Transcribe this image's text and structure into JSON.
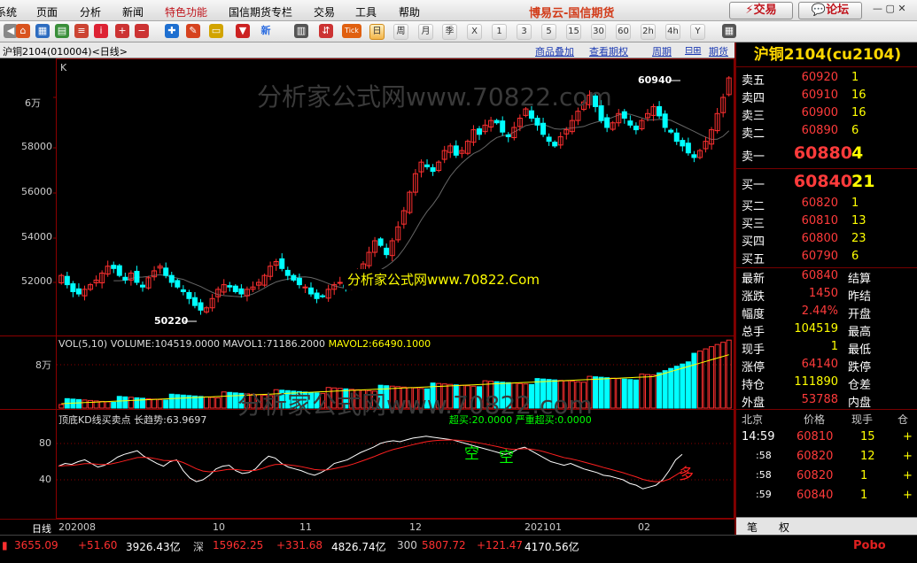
{
  "menu": [
    "系统",
    "页面",
    "分析",
    "新闻",
    "特色功能",
    "国信期货专栏",
    "交易",
    "工具",
    "帮助"
  ],
  "brand": "博易云-国信期货",
  "trade_btn": "交易",
  "forum_btn": "论坛",
  "toolbar_labels": [
    "新",
    "Tick",
    "日",
    "周",
    "月",
    "季",
    "X",
    "1",
    "3",
    "5",
    "15",
    "30",
    "60",
    "2h",
    "4h",
    "Y"
  ],
  "chart": {
    "title": "沪铜2104(010004)<日线>",
    "links": [
      "商品叠加",
      "查看期权",
      "周期",
      "期货"
    ],
    "k_label": "K",
    "high_label": "60940",
    "low_label": "50220",
    "y_ticks": [
      "6万",
      "58000",
      "56000",
      "54000",
      "52000"
    ],
    "watermark": "分析家公式网www.70822.com",
    "watermark2": "分析家公式网www.70822.Com",
    "vol_header": "VOL(5,10)  VOLUME:104519.0000  MAVOL1:71186.2000",
    "vol_mavol2": "MAVOL2:66490.1000",
    "vol_tick": "8万",
    "kd_header": "顶底KD线买卖点  长趋势:63.9697",
    "kd_extra": "超买:20.0000  严重超买:0.0000",
    "kd_ticks": [
      "80",
      "40"
    ],
    "kd_marks": [
      "空",
      "空",
      "多"
    ],
    "dates_label": "日线",
    "dates": [
      "202008",
      "10",
      "11",
      "12",
      "202101",
      "02"
    ]
  },
  "quote": {
    "title": "沪铜2104(cu2104)",
    "sells": [
      {
        "l": "卖五",
        "p": "60920",
        "v": "1"
      },
      {
        "l": "卖四",
        "p": "60910",
        "v": "16"
      },
      {
        "l": "卖三",
        "p": "60900",
        "v": "16"
      },
      {
        "l": "卖二",
        "p": "60890",
        "v": "6"
      }
    ],
    "sell1": {
      "l": "卖一",
      "p": "60880",
      "v": "4"
    },
    "buy1": {
      "l": "买一",
      "p": "60840",
      "v": "21"
    },
    "buys": [
      {
        "l": "买二",
        "p": "60820",
        "v": "1"
      },
      {
        "l": "买三",
        "p": "60810",
        "v": "13"
      },
      {
        "l": "买四",
        "p": "60800",
        "v": "23"
      },
      {
        "l": "买五",
        "p": "60790",
        "v": "6"
      }
    ],
    "stats": [
      {
        "l": "最新",
        "v": "60840",
        "r": "结算"
      },
      {
        "l": "涨跌",
        "v": "1450",
        "r": "昨结"
      },
      {
        "l": "幅度",
        "v": "2.44%",
        "r": "开盘"
      },
      {
        "l": "总手",
        "v": "104519",
        "r": "最高"
      },
      {
        "l": "现手",
        "v": "1",
        "r": "最低"
      },
      {
        "l": "涨停",
        "v": "64140",
        "r": "跌停"
      },
      {
        "l": "持仓",
        "v": "111890",
        "r": "仓差"
      },
      {
        "l": "外盘",
        "v": "53788",
        "r": "内盘"
      }
    ],
    "tick_head": [
      "北京",
      "价格",
      "现手",
      "仓"
    ],
    "ticks": [
      {
        "t": "14:59",
        "p": "60810",
        "v": "15",
        "f": "+"
      },
      {
        "t": ":58",
        "p": "60820",
        "v": "12",
        "f": "+"
      },
      {
        "t": ":58",
        "p": "60820",
        "v": "1",
        "f": "+"
      },
      {
        "t": ":59",
        "p": "60840",
        "v": "1",
        "f": "+"
      }
    ],
    "tabs": [
      "笔",
      "权"
    ]
  },
  "status": {
    "sh": "3655.09",
    "sh_chg": "+51.60",
    "sh_amt": "3926.43亿",
    "sz_label": "深",
    "sz": "15962.25",
    "sz_chg": "+331.68",
    "sz_amt": "4826.74亿",
    "c300_label": "300",
    "c300": "5807.72",
    "c300_chg": "+121.47",
    "c300_amt": "4170.56亿",
    "pobo": "Pobo"
  },
  "colors": {
    "up": "#ff3030",
    "down": "#00ffff",
    "ma": "#ffff00",
    "kd1": "#ffffff",
    "kd2": "#ff2020"
  }
}
